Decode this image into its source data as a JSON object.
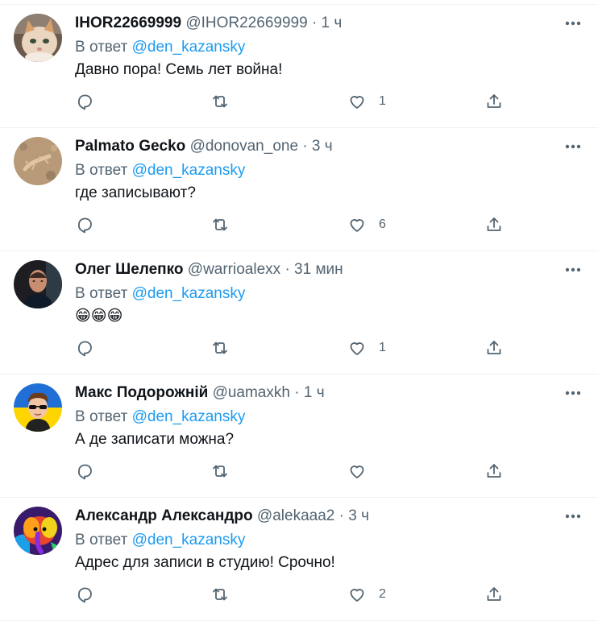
{
  "tweets": [
    {
      "name": "IHOR22669999",
      "handle": "@IHOR22669999",
      "sep": "·",
      "time": "1 ч",
      "reply_prefix": "В ответ",
      "reply_mention": "@den_kazansky",
      "text": "Давно пора! Семь лет война!",
      "likes": "1",
      "avatar": "kitten-avatar"
    },
    {
      "name": "Palmato Gecko",
      "handle": "@donovan_one",
      "sep": "·",
      "time": "3 ч",
      "reply_prefix": "В ответ",
      "reply_mention": "@den_kazansky",
      "text": "где записывают?",
      "likes": "6",
      "avatar": "gecko-avatar"
    },
    {
      "name": "Олег Шелепко",
      "handle": "@warrioalexx",
      "sep": "·",
      "time": "31 мин",
      "reply_prefix": "В ответ",
      "reply_mention": "@den_kazansky",
      "text": "😁😁😁",
      "likes": "1",
      "avatar": "man-photo-avatar"
    },
    {
      "name": "Макс Подорожній",
      "handle": "@uamaxkh",
      "sep": "·",
      "time": "1 ч",
      "reply_prefix": "В ответ",
      "reply_mention": "@den_kazansky",
      "text": "А де записати можна?",
      "likes": "",
      "avatar": "cartoon-sunglasses-avatar"
    },
    {
      "name": "Александр Александро",
      "handle": "@alekaaa2",
      "sep": "·",
      "time": "3 ч",
      "reply_prefix": "В ответ",
      "reply_mention": "@den_kazansky",
      "text": "Адрес для записи в студию! Срочно!",
      "likes": "2",
      "avatar": "colorful-elephant-avatar"
    }
  ],
  "colors": {
    "text": "#0f1419",
    "secondary": "#536471",
    "link": "#1d9bf0",
    "divider": "#eff3f4"
  }
}
